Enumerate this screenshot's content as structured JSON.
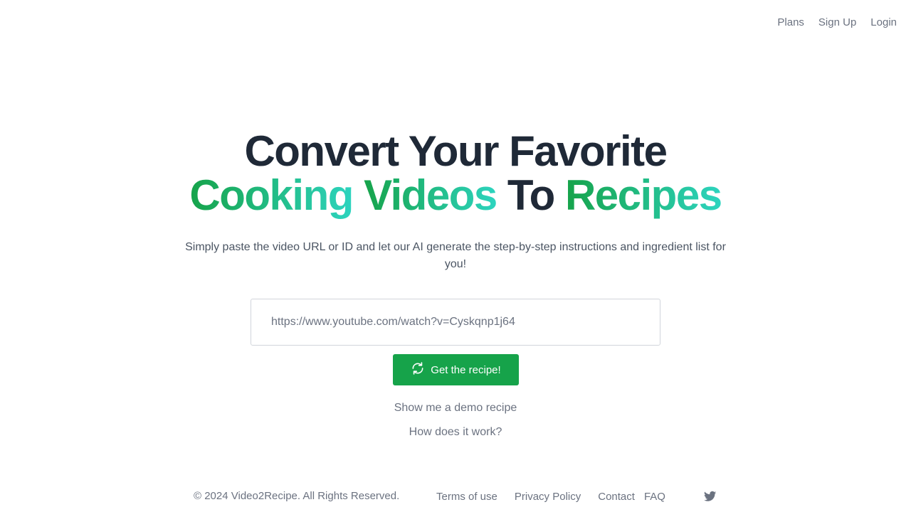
{
  "nav": {
    "plans": "Plans",
    "sign_up": "Sign Up",
    "login": "Login"
  },
  "hero": {
    "title_line1": "Convert Your Favorite",
    "title_word_cooking": "Cooking",
    "title_word_videos": "Videos",
    "title_word_to": "To",
    "title_word_recipes": "Recipes",
    "subtitle": "Simply paste the video URL or ID and let our AI generate the step-by-step instructions and ingredient list for you!"
  },
  "url_input": {
    "value": "",
    "placeholder": "https://www.youtube.com/watch?v=Cyskqnp1j64"
  },
  "actions": {
    "button_icon": "refresh-icon",
    "get_recipe_label": "Get the recipe!",
    "demo_link": "Show me a demo recipe",
    "how_link": "How does it work?"
  },
  "footer": {
    "copyright": "© 2024 Video2Recipe. All Rights Reserved.",
    "terms": "Terms of use",
    "privacy": "Privacy Policy",
    "contact": "Contact",
    "faq": "FAQ",
    "social_icon": "twitter-icon"
  },
  "colors": {
    "brand_green": "#16a34a",
    "brand_teal": "#2dd4bf",
    "heading_dark": "#1f2937",
    "muted_text": "#6b7280"
  }
}
